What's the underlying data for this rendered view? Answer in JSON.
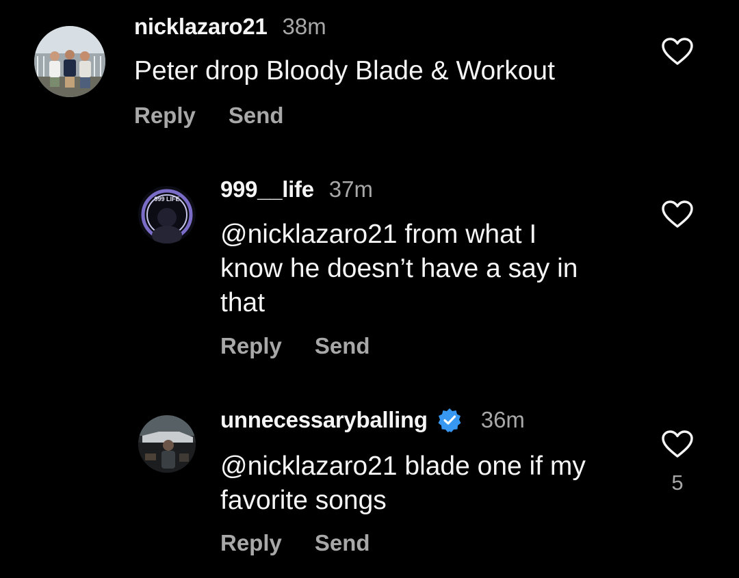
{
  "comments": [
    {
      "username": "nicklazaro21",
      "time": "38m",
      "text": "Peter drop Bloody Blade & Workout",
      "reply_label": "Reply",
      "send_label": "Send",
      "avatar_icon": "group-photo-avatar"
    },
    {
      "username": "999__life",
      "time": "37m",
      "text_lines": [
        "@nicklazaro21 from what I",
        "know he doesn’t have a say in",
        "that"
      ],
      "reply_label": "Reply",
      "send_label": "Send",
      "avatar_icon": "999-life-logo-avatar",
      "avatar_text": "999 LIFE"
    },
    {
      "username": "unnecessaryballing",
      "verified": true,
      "time": "36m",
      "text_lines": [
        "@nicklazaro21 blade one if my",
        "favorite songs"
      ],
      "reply_label": "Reply",
      "send_label": "Send",
      "like_count": "5",
      "avatar_icon": "car-photo-avatar"
    }
  ],
  "colors": {
    "background": "#000000",
    "primary_text": "#f5f5f5",
    "secondary_text": "#a8a8a8",
    "verified_badge": "#3897f0"
  }
}
